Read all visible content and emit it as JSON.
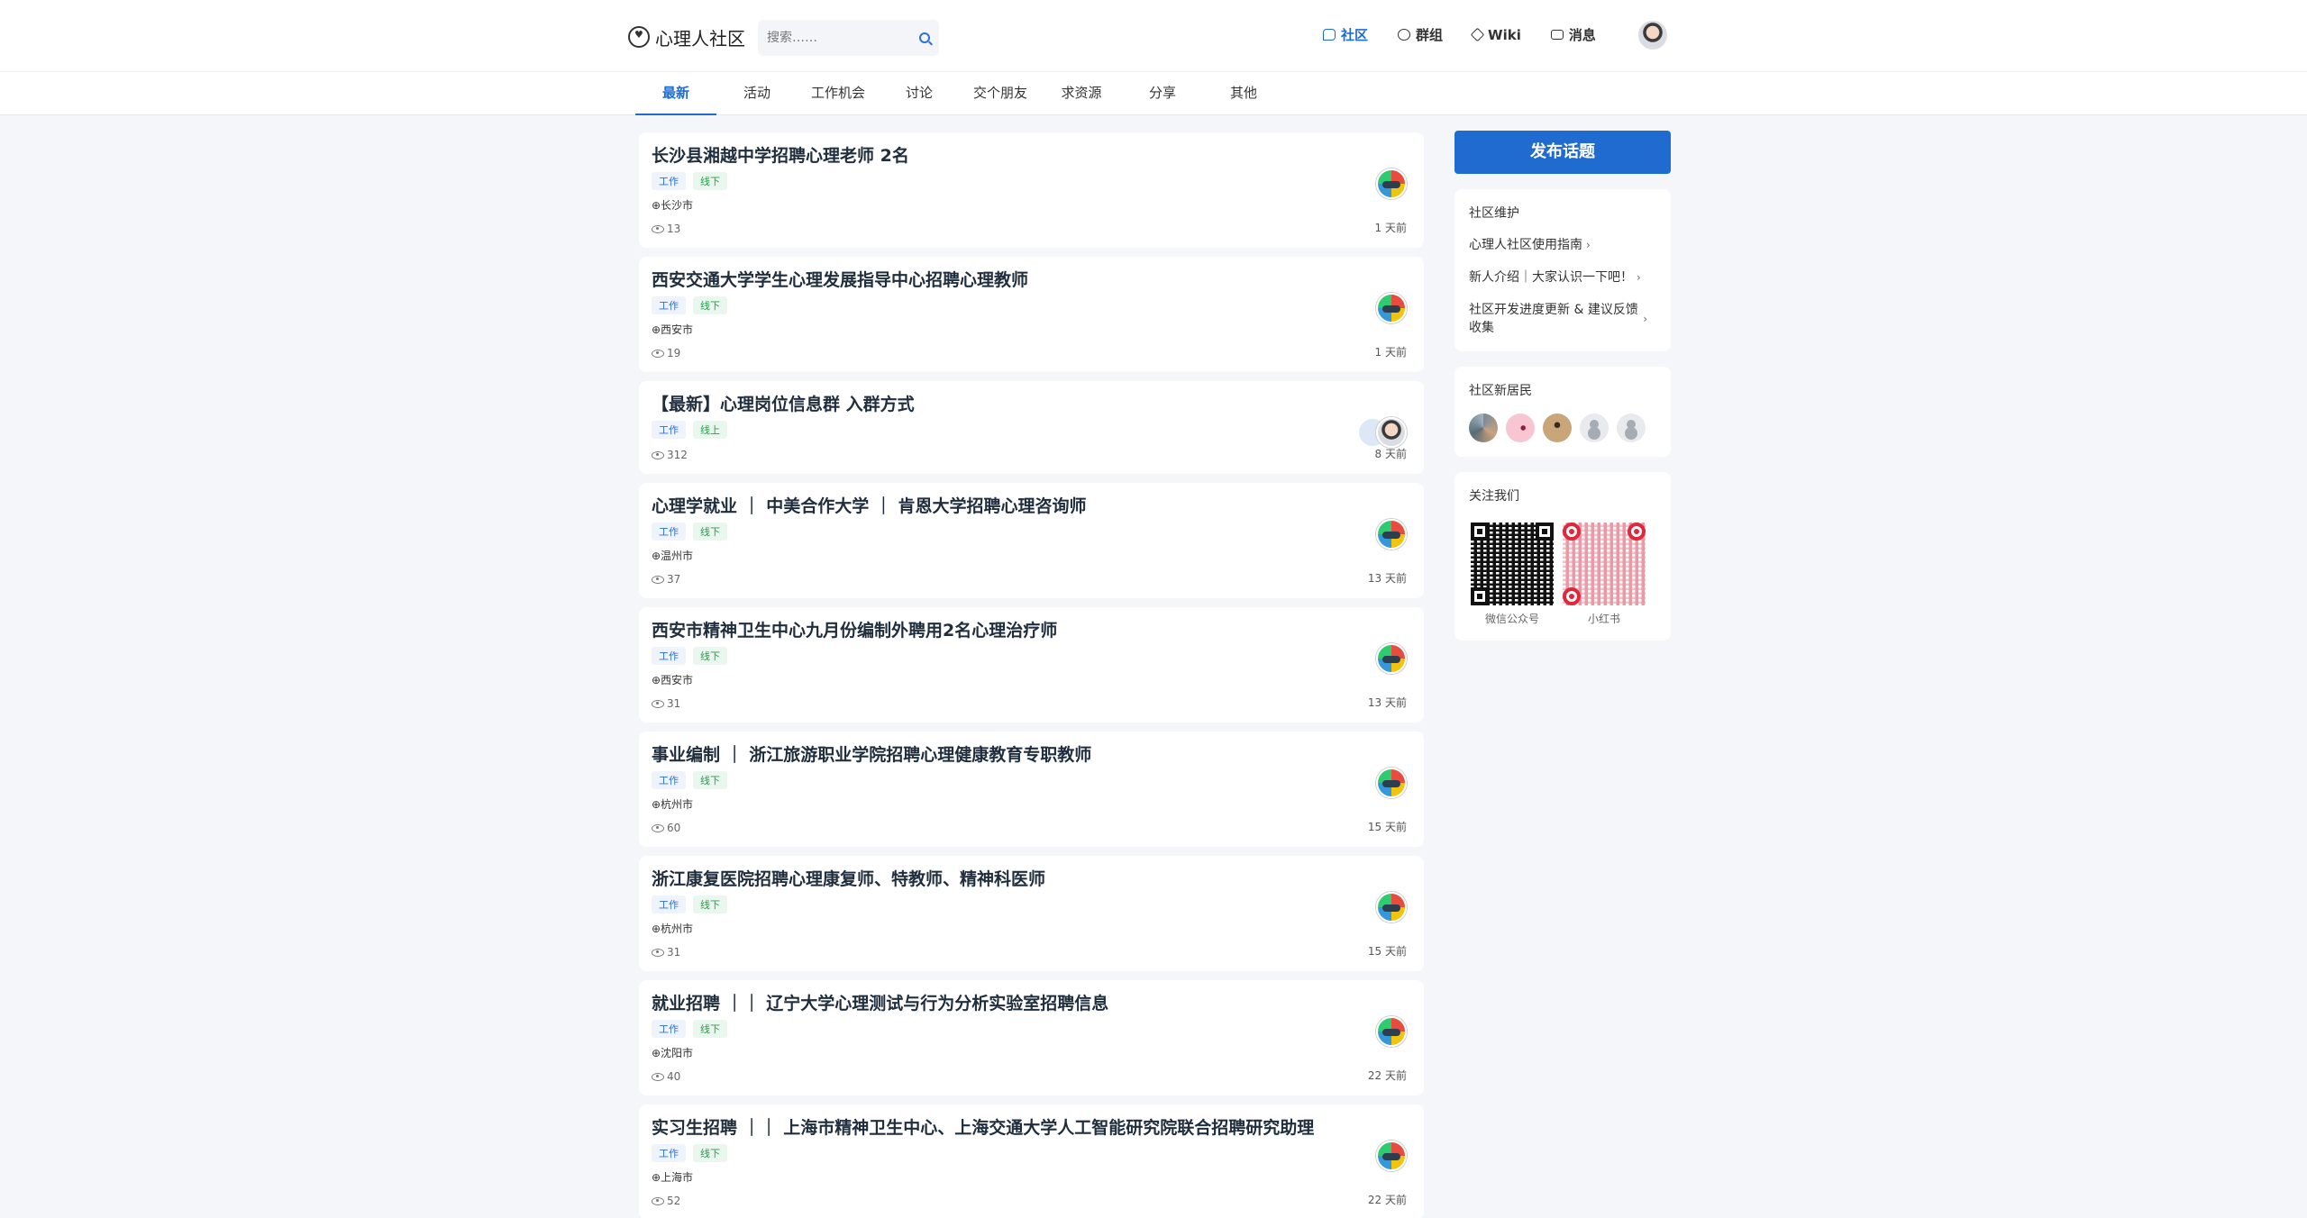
{
  "header": {
    "logo_text": "心理人社区",
    "search_placeholder": "搜索……",
    "nav": [
      {
        "label": "社区",
        "icon": "chat-icon",
        "active": true
      },
      {
        "label": "群组",
        "icon": "group-icon",
        "active": false
      },
      {
        "label": "Wiki",
        "icon": "wiki-icon",
        "active": false
      },
      {
        "label": "消息",
        "icon": "mail-icon",
        "active": false
      }
    ]
  },
  "tabs": [
    "最新",
    "活动",
    "工作机会",
    "讨论",
    "交个朋友",
    "求资源",
    "分享",
    "其他"
  ],
  "posts": [
    {
      "title": "长沙县湘越中学招聘心理老师 2名",
      "tags": [
        "工作",
        "线下"
      ],
      "location": "⊕长沙市",
      "views": "13",
      "time": "1 天前"
    },
    {
      "title": "西安交通大学学生心理发展指导中心招聘心理教师",
      "tags": [
        "工作",
        "线下"
      ],
      "location": "⊕西安市",
      "views": "19",
      "time": "1 天前"
    },
    {
      "title": "【最新】心理岗位信息群 入群方式",
      "tags": [
        "工作",
        "线上"
      ],
      "location": "",
      "views": "312",
      "time": "8 天前"
    },
    {
      "title": "心理学就业 ｜ 中美合作大学 ｜ 肯恩大学招聘心理咨询师",
      "tags": [
        "工作",
        "线下"
      ],
      "location": "⊕温州市",
      "views": "37",
      "time": "13 天前"
    },
    {
      "title": "西安市精神卫生中心九月份编制外聘用2名心理治疗师",
      "tags": [
        "工作",
        "线下"
      ],
      "location": "⊕西安市",
      "views": "31",
      "time": "13 天前"
    },
    {
      "title": "事业编制 ｜ 浙江旅游职业学院招聘心理健康教育专职教师",
      "tags": [
        "工作",
        "线下"
      ],
      "location": "⊕杭州市",
      "views": "60",
      "time": "15 天前"
    },
    {
      "title": "浙江康复医院招聘心理康复师、特教师、精神科医师",
      "tags": [
        "工作",
        "线下"
      ],
      "location": "⊕杭州市",
      "views": "31",
      "time": "15 天前"
    },
    {
      "title": "就业招聘 ｜｜ 辽宁大学心理测试与行为分析实验室招聘信息",
      "tags": [
        "工作",
        "线下"
      ],
      "location": "⊕沈阳市",
      "views": "40",
      "time": "22 天前"
    },
    {
      "title": "实习生招聘 ｜｜ 上海市精神卫生中心、上海交通大学人工智能研究院联合招聘研究助理",
      "tags": [
        "工作",
        "线下"
      ],
      "location": "⊕上海市",
      "views": "52",
      "time": "22 天前"
    }
  ],
  "sidebar": {
    "publish_label": "发布话题",
    "maintenance": {
      "title": "社区维护",
      "links": [
        "心理人社区使用指南",
        "新人介绍｜大家认识一下吧！",
        "社区开发进度更新 & 建议反馈收集"
      ]
    },
    "new_members": {
      "title": "社区新居民"
    },
    "follow": {
      "title": "关注我们",
      "items": [
        {
          "caption": "微信公众号"
        },
        {
          "caption": "小红书"
        }
      ]
    }
  }
}
